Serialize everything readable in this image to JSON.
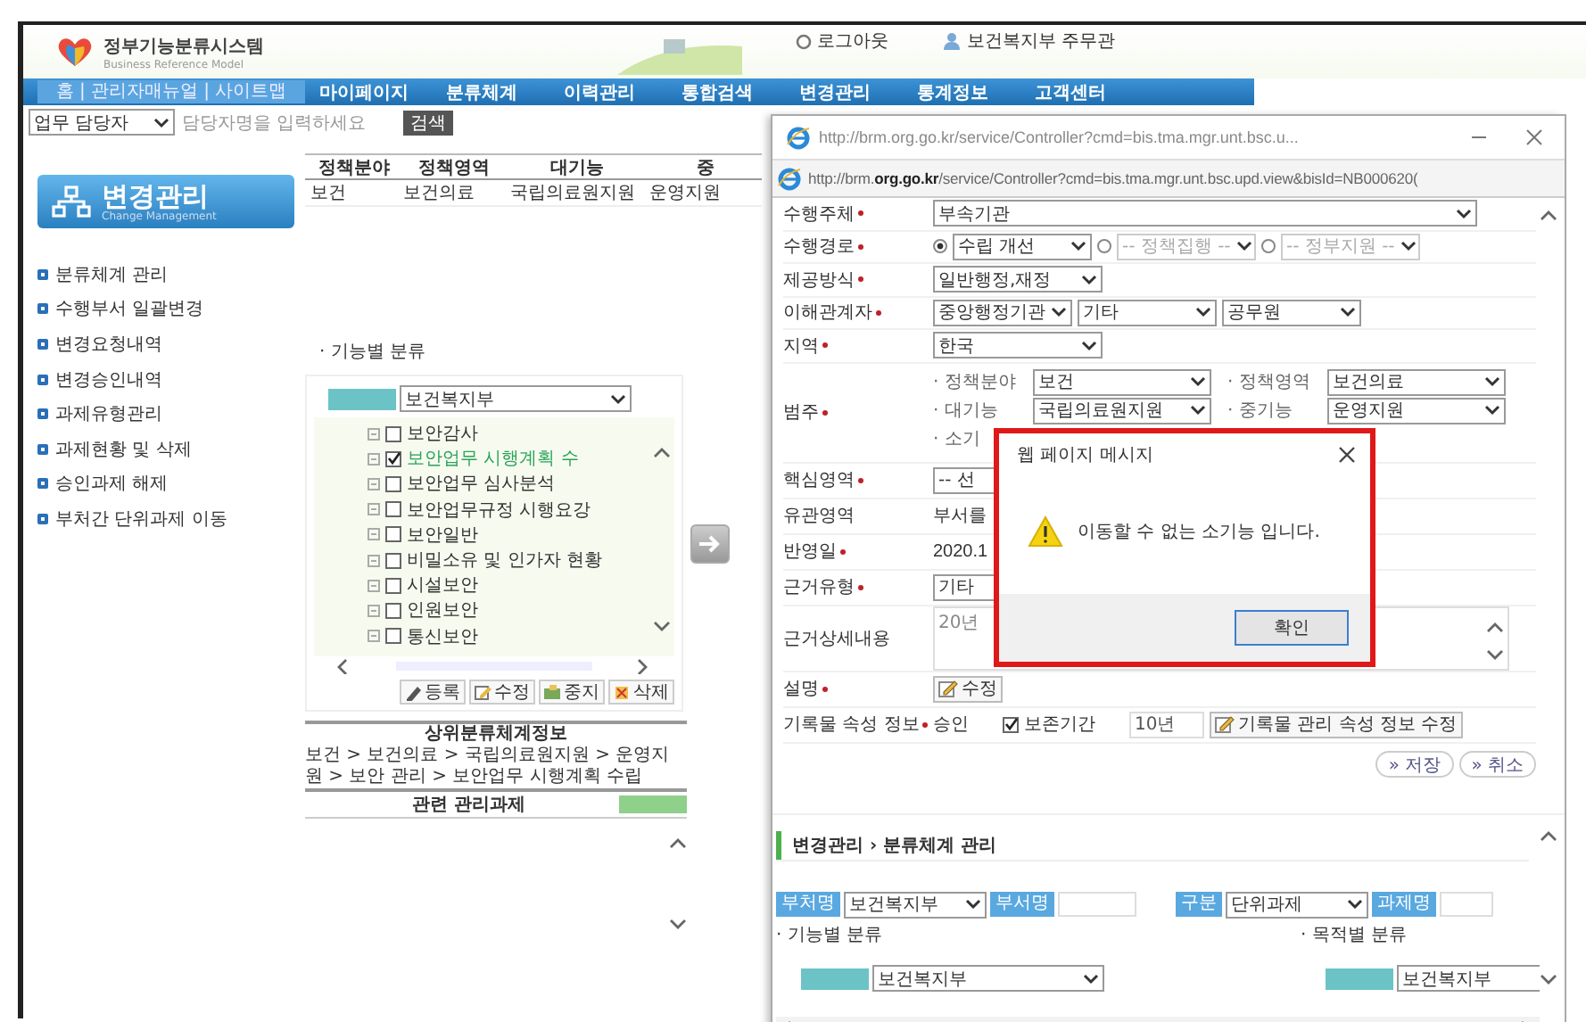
{
  "header": {
    "system_name": "정부기능분류시스템",
    "tagline": "Business Reference Model",
    "logout": "로그아웃",
    "user": "보건복지부 주무관"
  },
  "nav": {
    "home_links": "홈 | 관리자매뉴얼 | 사이트맵",
    "items": [
      "마이페이지",
      "분류체계",
      "이력관리",
      "통합검색",
      "변경관리",
      "통계정보",
      "고객센터"
    ]
  },
  "search": {
    "field_select": "업무 담당자",
    "placeholder": "담당자명을 입력하세요",
    "button": "검색"
  },
  "sidebar": {
    "title": "변경관리",
    "subtitle": "Change Management",
    "items": [
      "분류체계 관리",
      "수행부서 일괄변경",
      "변경요청내역",
      "변경승인내역",
      "과제유형관리",
      "과제현황 및 삭제",
      "승인과제 해제",
      "부처간 단위과제 이동"
    ]
  },
  "summary_table": {
    "columns": [
      "정책분야",
      "정책영역",
      "대기능",
      "중"
    ],
    "rows": [
      [
        "보건",
        "보건의료",
        "국립의료원지원",
        "운영지원"
      ]
    ]
  },
  "function_tree": {
    "label": "· 기능별 분류",
    "ministry": "보건복지부",
    "items": [
      {
        "label": "보안감사",
        "checked": false,
        "selected": false
      },
      {
        "label": "보안업무 시행계획 수",
        "checked": true,
        "selected": true
      },
      {
        "label": "보안업무 심사분석",
        "checked": false,
        "selected": false
      },
      {
        "label": "보안업무규정 시행요강",
        "checked": false,
        "selected": false
      },
      {
        "label": "보안일반",
        "checked": false,
        "selected": false
      },
      {
        "label": "비밀소유 및 인가자 현황",
        "checked": false,
        "selected": false
      },
      {
        "label": "시설보안",
        "checked": false,
        "selected": false
      },
      {
        "label": "인원보안",
        "checked": false,
        "selected": false
      },
      {
        "label": "통신보안",
        "checked": false,
        "selected": false
      }
    ],
    "buttons": [
      "등록",
      "수정",
      "중지",
      "삭제"
    ]
  },
  "parent_info": {
    "title": "상위분류체계정보",
    "path": "보건 > 보건의료 > 국립의료원지원 > 운영지원 > 보안 관리 > 보안업무 시행계획 수립"
  },
  "related_tasks": {
    "title": "관련 관리과제"
  },
  "popup": {
    "title": "http://brm.org.go.kr/service/Controller?cmd=bis.tma.mgr.unt.bsc.u...",
    "address": "http://brm.**org.go.kr**/service/Controller?cmd=bis.tma.mgr.unt.bsc.upd.view&bisId=NB000620(",
    "form": [
      {
        "label": "수행주체",
        "required": true,
        "fields": [
          {
            "kind": "select",
            "value": "부속기관"
          }
        ]
      },
      {
        "label": "수행경로",
        "required": true,
        "fields": [
          {
            "kind": "radio-select",
            "selected": true,
            "disabled": false,
            "value": "수립 개선"
          },
          {
            "kind": "radio-select",
            "selected": false,
            "disabled": true,
            "value": "-- 정책집행 --"
          },
          {
            "kind": "radio-select",
            "selected": false,
            "disabled": true,
            "value": "-- 정부지원 --"
          }
        ]
      },
      {
        "label": "제공방식",
        "required": true,
        "fields": [
          {
            "kind": "select",
            "value": "일반행정,재정"
          }
        ]
      },
      {
        "label": "이해관계자",
        "required": true,
        "fields": [
          {
            "kind": "select",
            "value": "중앙행정기관"
          },
          {
            "kind": "select",
            "value": "기타"
          },
          {
            "kind": "select",
            "value": "공무원"
          }
        ]
      },
      {
        "label": "지역",
        "required": true,
        "fields": [
          {
            "kind": "select",
            "value": "한국"
          }
        ]
      },
      {
        "label": "범주",
        "required": true,
        "fields": [
          {
            "kind": "sub-grid",
            "items": [
              {
                "label": "· 정책분야",
                "value": "보건"
              },
              {
                "label": "· 정책영역",
                "value": "보건의료"
              },
              {
                "label": "· 대기능",
                "value": "국립의료원지원"
              },
              {
                "label": "· 중기능",
                "value": "운영지원"
              },
              {
                "label": "· 소기"
              }
            ]
          }
        ]
      },
      {
        "label": "핵심영역",
        "required": true,
        "fields": [
          {
            "kind": "select",
            "value": "-- 선"
          }
        ]
      },
      {
        "label": "유관영역",
        "required": false,
        "fields": [
          {
            "kind": "text",
            "value": "부서를"
          }
        ]
      },
      {
        "label": "반영일",
        "required": true,
        "fields": [
          {
            "kind": "text",
            "value": "2020.1"
          }
        ]
      },
      {
        "label": "근거유형",
        "required": true,
        "fields": [
          {
            "kind": "select",
            "value": "기타"
          }
        ]
      },
      {
        "label": "근거상세내용",
        "required": false,
        "fields": [
          {
            "kind": "textarea",
            "value": "20년"
          }
        ]
      },
      {
        "label": "설명",
        "required": true,
        "fields": [
          {
            "kind": "edit-button",
            "label": "수정"
          }
        ]
      },
      {
        "label": "기록물 속성 정보",
        "required": true,
        "fields": [
          {
            "kind": "text",
            "value": "승인"
          },
          {
            "kind": "checkbox",
            "checked": true
          },
          {
            "kind": "text",
            "value": "보존기간"
          },
          {
            "kind": "input",
            "value": "10년"
          },
          {
            "kind": "edit-button",
            "label": "기록물 관리 속성 정보 수정"
          }
        ]
      }
    ],
    "actions": [
      "» 저장",
      "» 취소"
    ],
    "section_title": "변경관리 › 분류체계 관리",
    "filters": [
      {
        "label": "부처명",
        "kind": "select",
        "value": "보건복지부"
      },
      {
        "label": "부서명",
        "kind": "input"
      },
      {
        "label": "구분",
        "kind": "select",
        "value": "단위과제"
      },
      {
        "label": "과제명",
        "kind": "input"
      }
    ],
    "panels": [
      {
        "title": "· 기능별 분류",
        "ministry": "보건복지부"
      },
      {
        "title": "· 목적별 분류",
        "ministry": "보건복지부"
      }
    ]
  },
  "dialog": {
    "title": "웹 페이지 메시지",
    "message": "이동할 수 없는 소기능 입니다.",
    "button": "확인"
  }
}
